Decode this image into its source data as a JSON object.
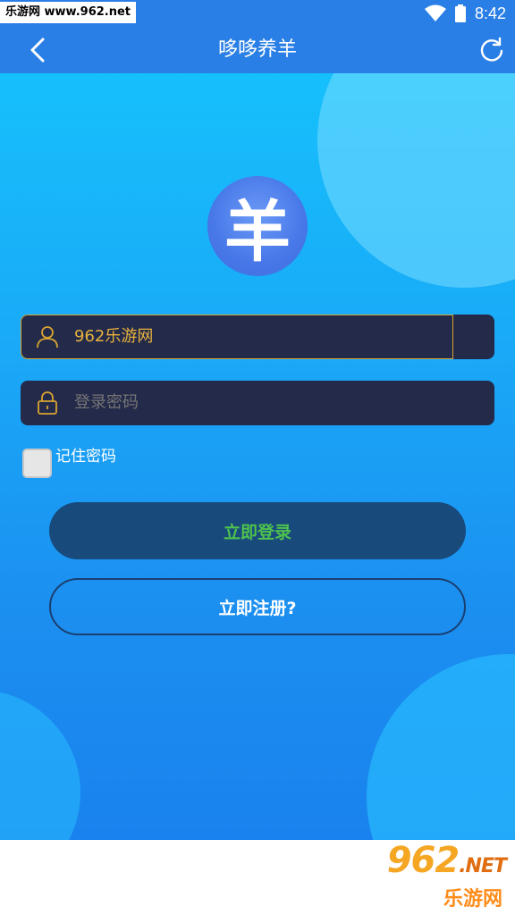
{
  "status_bar": {
    "watermark": "乐游网 www.962.net",
    "time": "8:42"
  },
  "header": {
    "title": "哆哆养羊",
    "back_icon": "chevron-left-icon",
    "refresh_icon": "refresh-icon"
  },
  "logo": {
    "text": "羊"
  },
  "login_form": {
    "username_value": "962乐游网",
    "password_placeholder": "登录密码",
    "remember_label": "记住密码",
    "remember_checked": false,
    "login_button_label": "立即登录",
    "register_button_label": "立即注册?"
  },
  "watermark_bottom": {
    "number": "962",
    "net": ".NET",
    "name": "乐游网"
  },
  "colors": {
    "header_bg": "#2a7fe6",
    "field_bg": "#242a4a",
    "accent_gold": "#d8a531",
    "login_text": "#4ec24e"
  }
}
